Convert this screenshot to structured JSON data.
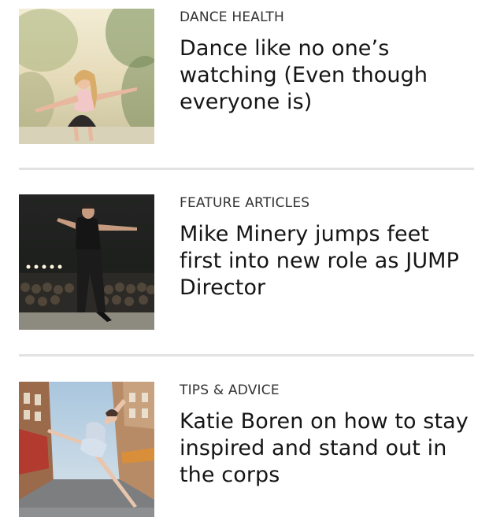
{
  "articles": [
    {
      "image": "girl-dancing-outdoors-photo",
      "category": "DANCE HEALTH",
      "title": "Dance like no one’s watching (Even though everyone is)"
    },
    {
      "image": "man-dancing-on-stage-photo",
      "category": "FEATURE ARTICLES",
      "title": "Mike Minery jumps feet first into new role as JUMP Director"
    },
    {
      "image": "ballerina-leaping-in-street-photo",
      "category": "TIPS & ADVICE",
      "title": "Katie Boren on how to stay inspired and stand out in the corps"
    }
  ],
  "colors": {
    "divider": "#e2e2e2",
    "text": "#151515",
    "category": "#333333"
  }
}
